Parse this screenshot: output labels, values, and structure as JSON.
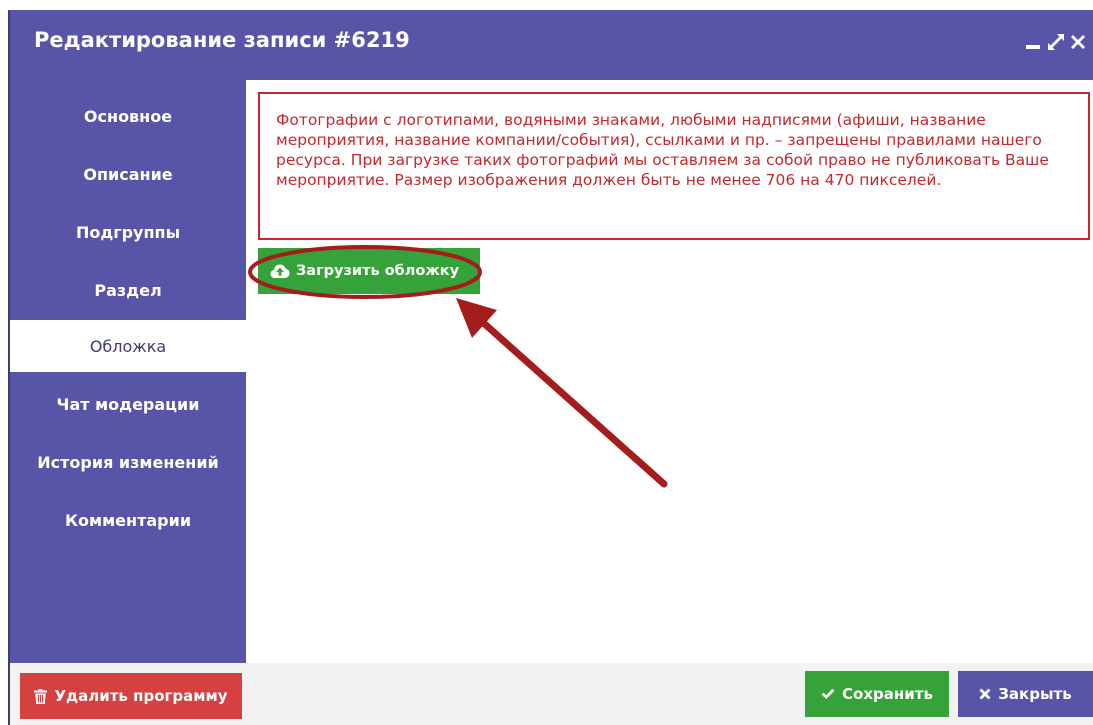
{
  "window": {
    "title": "Редактирование записи #6219"
  },
  "sidebar": {
    "items": [
      {
        "label": "Основное"
      },
      {
        "label": "Описание"
      },
      {
        "label": "Подгруппы"
      },
      {
        "label": "Раздел"
      },
      {
        "label": "Обложка",
        "active": true
      },
      {
        "label": "Чат модерации"
      },
      {
        "label": "История изменений"
      },
      {
        "label": "Комментарии"
      }
    ]
  },
  "main": {
    "notice_text": "Фотографии с логотипами, водяными знаками, любыми надписями (афиши, название мероприятия, название компании/события), ссылками и пр. – запрещены правилами нашего ресурса. При загрузке таких фотографий мы оставляем за собой право не публиковать Ваше мероприятие. Размер изображения должен быть не менее 706 на 470 пикселей.",
    "upload_label": "Загрузить обложку"
  },
  "footer": {
    "delete_label": "Удалить программу",
    "save_label": "Сохранить",
    "close_label": "Закрыть"
  },
  "colors": {
    "header": "#5855a9",
    "notice_red": "#c4282c",
    "green": "#36a33a",
    "delete_red": "#d54040",
    "annotation": "#a51c1c"
  },
  "icons": {
    "window_minimize": "minimize-icon",
    "window_maximize": "expand-icon",
    "window_close": "close-icon",
    "upload": "cloud-upload-icon",
    "delete": "trash-icon",
    "save": "check-icon",
    "close": "close-icon"
  }
}
